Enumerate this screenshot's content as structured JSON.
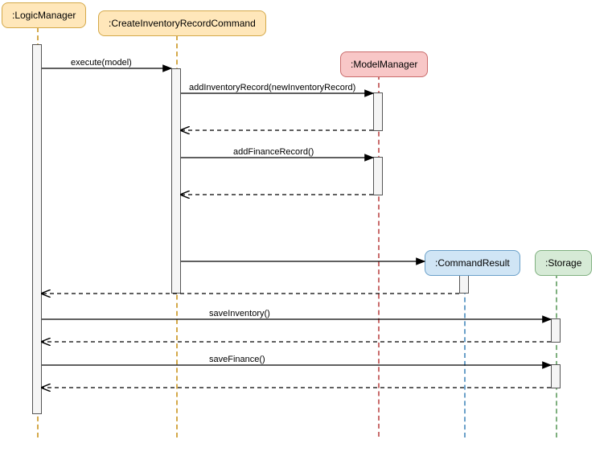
{
  "participants": {
    "logicManager": ":LogicManager",
    "createCmd": ":CreateInventoryRecordCommand",
    "modelManager": ":ModelManager",
    "commandResult": ":CommandResult",
    "storage": ":Storage"
  },
  "messages": {
    "execute": "execute(model)",
    "addInventoryRecord": "addInventoryRecord(newInventoryRecord)",
    "addFinanceRecord": "addFinanceRecord()",
    "saveInventory": "saveInventory()",
    "saveFinance": "saveFinance()"
  },
  "chart_data": {
    "type": "sequence-diagram",
    "participants": [
      {
        "name": ":LogicManager",
        "color": "yellow"
      },
      {
        "name": ":CreateInventoryRecordCommand",
        "color": "yellow"
      },
      {
        "name": ":ModelManager",
        "color": "red"
      },
      {
        "name": ":CommandResult",
        "color": "blue",
        "createdAt": 7
      },
      {
        "name": ":Storage",
        "color": "green",
        "createdAt": 7
      }
    ],
    "messages": [
      {
        "from": ":LogicManager",
        "to": ":CreateInventoryRecordCommand",
        "label": "execute(model)",
        "type": "call"
      },
      {
        "from": ":CreateInventoryRecordCommand",
        "to": ":ModelManager",
        "label": "addInventoryRecord(newInventoryRecord)",
        "type": "call"
      },
      {
        "from": ":ModelManager",
        "to": ":CreateInventoryRecordCommand",
        "label": "",
        "type": "return"
      },
      {
        "from": ":CreateInventoryRecordCommand",
        "to": ":ModelManager",
        "label": "addFinanceRecord()",
        "type": "call"
      },
      {
        "from": ":ModelManager",
        "to": ":CreateInventoryRecordCommand",
        "label": "",
        "type": "return"
      },
      {
        "from": ":CreateInventoryRecordCommand",
        "to": ":CommandResult",
        "label": "",
        "type": "create"
      },
      {
        "from": ":CommandResult",
        "to": ":LogicManager",
        "label": "",
        "type": "return"
      },
      {
        "from": ":LogicManager",
        "to": ":Storage",
        "label": "saveInventory()",
        "type": "call"
      },
      {
        "from": ":Storage",
        "to": ":LogicManager",
        "label": "",
        "type": "return"
      },
      {
        "from": ":LogicManager",
        "to": ":Storage",
        "label": "saveFinance()",
        "type": "call"
      },
      {
        "from": ":Storage",
        "to": ":LogicManager",
        "label": "",
        "type": "return"
      }
    ]
  }
}
